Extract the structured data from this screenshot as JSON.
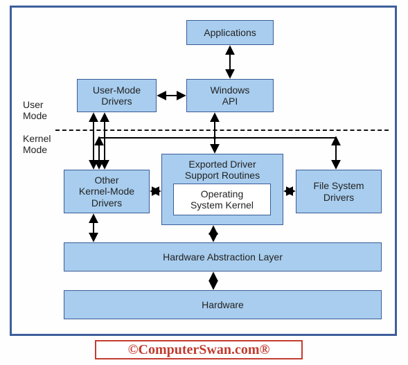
{
  "labels": {
    "user_mode": "User\nMode",
    "kernel_mode": "Kernel\nMode"
  },
  "boxes": {
    "applications": "Applications",
    "user_mode_drivers": "User-Mode\nDrivers",
    "windows_api": "Windows\nAPI",
    "other_kernel_drivers": "Other\nKernel-Mode\nDrivers",
    "exported_routines": "Exported Driver\nSupport Routines",
    "os_kernel": "Operating\nSystem Kernel",
    "file_system_drivers": "File System\nDrivers",
    "hal": "Hardware Abstraction Layer",
    "hardware": "Hardware"
  },
  "attribution": "©ComputerSwan.com®",
  "colors": {
    "frame": "#3e5f9b",
    "box_fill": "#a8cdee",
    "box_border": "#3a5b98",
    "attribution": "#c33c2f"
  }
}
